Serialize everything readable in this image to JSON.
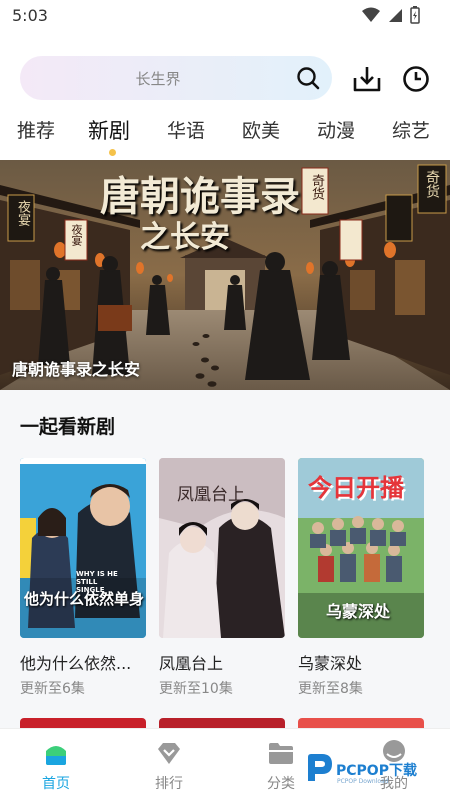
{
  "status_bar": {
    "time": "5:03"
  },
  "search": {
    "placeholder": "长生界"
  },
  "tabs": [
    {
      "label": "推荐"
    },
    {
      "label": "新剧"
    },
    {
      "label": "华语"
    },
    {
      "label": "欧美"
    },
    {
      "label": "动漫"
    },
    {
      "label": "综艺"
    }
  ],
  "active_tab_index": 1,
  "banner": {
    "caption": "唐朝诡事录之长安",
    "poster_title_line1": "唐朝诡事录",
    "poster_title_line2": "之长安",
    "sign_left": "夜宴",
    "sign_left2": "夜宴",
    "sign_right": "奇货",
    "sign_right2": "奇货"
  },
  "section": {
    "title": "一起看新剧"
  },
  "cards": [
    {
      "title": "他为什么依然...",
      "subtitle": "更新至6集",
      "poster_text": "他为什么依然单身",
      "poster_en": "WHY IS HE STILL SINGLE",
      "accent": "#3aa3d8"
    },
    {
      "title": "凤凰台上",
      "subtitle": "更新至10集",
      "poster_text": "凤凰台上",
      "accent": "#d8ccd0"
    },
    {
      "title": "乌蒙深处",
      "subtitle": "更新至8集",
      "poster_text": "今日开播",
      "poster_text2": "乌蒙深处",
      "accent": "#7bb368"
    }
  ],
  "nav": [
    {
      "label": "首页",
      "icon": "home-icon"
    },
    {
      "label": "排行",
      "icon": "ranking-icon"
    },
    {
      "label": "分类",
      "icon": "category-icon"
    },
    {
      "label": "我的",
      "icon": "profile-icon"
    }
  ],
  "active_nav_index": 0,
  "watermark": {
    "text": "PCPOP下载",
    "small": "PCPOP Download"
  },
  "colors": {
    "accent": "#1aa5e0",
    "tab_dot": "#f5c24a",
    "section_bg": "#f6f7f9"
  }
}
